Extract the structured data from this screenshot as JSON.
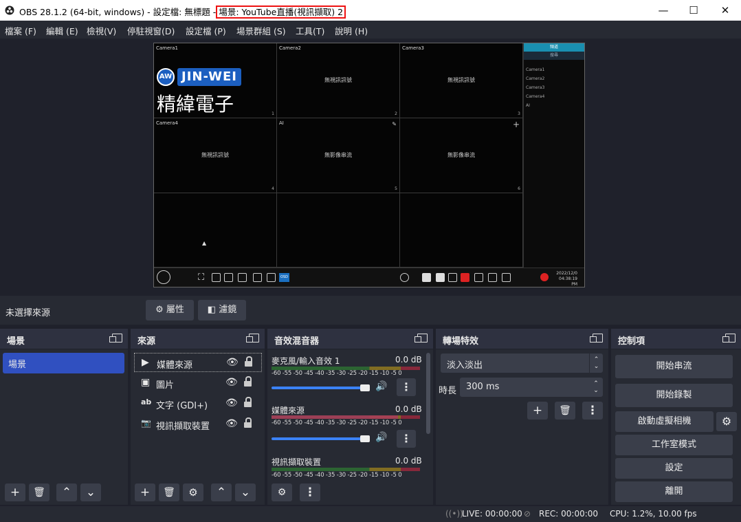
{
  "window": {
    "title_prefix": "OBS 28.1.2 (64-bit, windows) - 設定檔: 無標題 -",
    "title_scene": "場景: YouTube直播(視訊擷取) 2",
    "minimize": "—",
    "maximize": "☐",
    "close": "✕"
  },
  "menu": [
    "檔案 (F)",
    "編輯 (E)",
    "檢視(V)",
    "停駐視窗(D)",
    "設定檔 (P)",
    "場景群組 (S)",
    "工具(T)",
    "說明 (H)"
  ],
  "preview": {
    "cameras": [
      {
        "label": "Camera1",
        "num": "1",
        "msg": ""
      },
      {
        "label": "Camera2",
        "num": "2",
        "msg": "無視訊訊號"
      },
      {
        "label": "Camera3",
        "num": "3",
        "msg": "無視訊訊號"
      },
      {
        "label": "Camera4",
        "num": "4",
        "msg": "無視訊訊號"
      },
      {
        "label": "AI",
        "num": "5",
        "msg": "無影像串流"
      },
      {
        "label": "",
        "num": "6",
        "msg": "無影像串流"
      }
    ],
    "logo_text": "JIN-WEI",
    "logo_mark": "AW",
    "logo_sub": "精緯電子",
    "side_header1": "頻道",
    "side_header2": "搜尋",
    "side_items": [
      "Camera1",
      "Camera2",
      "Camera3",
      "Camera4",
      "AI"
    ],
    "osd": "OSD",
    "date": "2022/12/0",
    "time": "04:38:19 PM"
  },
  "sourcebar": {
    "status": "未選擇來源",
    "props": "屬性",
    "filters": "濾鏡"
  },
  "scenes": {
    "title": "場景",
    "items": [
      "場景"
    ]
  },
  "sources": {
    "title": "來源",
    "items": [
      {
        "name": "媒體來源",
        "icon": "▶"
      },
      {
        "name": "圖片",
        "icon": "▣"
      },
      {
        "name": "文字 (GDI+)",
        "icon": "ab"
      },
      {
        "name": "視訊擷取裝置",
        "icon": "📷"
      }
    ]
  },
  "mixer": {
    "title": "音效混音器",
    "ticks": "-60 -55 -50 -45 -40 -35 -30 -25 -20 -15 -10  -5   0",
    "channels": [
      {
        "name": "麥克風/輸入音效 1",
        "db": "0.0 dB",
        "level": 0
      },
      {
        "name": "媒體來源",
        "db": "0.0 dB",
        "level": 0.85
      },
      {
        "name": "視訊擷取裝置",
        "db": "0.0 dB",
        "level": 0
      }
    ]
  },
  "transitions": {
    "title": "轉場特效",
    "selected": "淡入淡出",
    "duration_label": "時長",
    "duration": "300 ms"
  },
  "controls": {
    "title": "控制項",
    "buttons": [
      "開始串流",
      "開始錄製",
      "啟動虛擬相機",
      "工作室模式",
      "設定",
      "離開"
    ]
  },
  "status": {
    "live": "LIVE: 00:00:00",
    "rec": "REC: 00:00:00",
    "cpu": "CPU: 1.2%, 10.00 fps"
  },
  "colors": {
    "accent": "#3050c0",
    "meter_green": "#2e7d32",
    "meter_yellow": "#a88a1a",
    "meter_red": "#b0283e"
  }
}
